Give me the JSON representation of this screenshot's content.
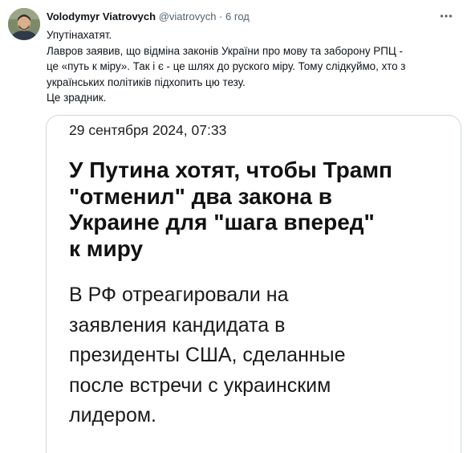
{
  "tweet": {
    "author": {
      "name": "Volodymyr Viatrovych",
      "handle": "@viatrovych",
      "separator": "·",
      "time": "6 год"
    },
    "text_lines": [
      "Упутінахатят.",
      "Лавров заявив, що відміна законів України про мову та заборону РПЦ -",
      "це «путь к міру». Так і є - це шлях до руского міру. Тому слідкуймо, хто з",
      "українських політиків підхопить цю тезу.",
      "Це зрадник."
    ],
    "media": {
      "date": "29 сентября 2024, 07:33",
      "headline_lines": [
        "У Путина хотят, чтобы Трамп",
        "\"отменил\" два закона в",
        "Украине для \"шага вперед\"",
        "к миру"
      ],
      "lead_lines": [
        "В РФ отреагировали на",
        "заявления кандидата в",
        "президенты США, сделанные",
        "после встречи с украинским",
        "лидером."
      ]
    }
  },
  "icons": {
    "avatar": "profile-photo",
    "more": "more-horizontal-icon"
  },
  "colors": {
    "text": "#0f1419",
    "secondary": "#536471",
    "border": "#cfd9de"
  }
}
